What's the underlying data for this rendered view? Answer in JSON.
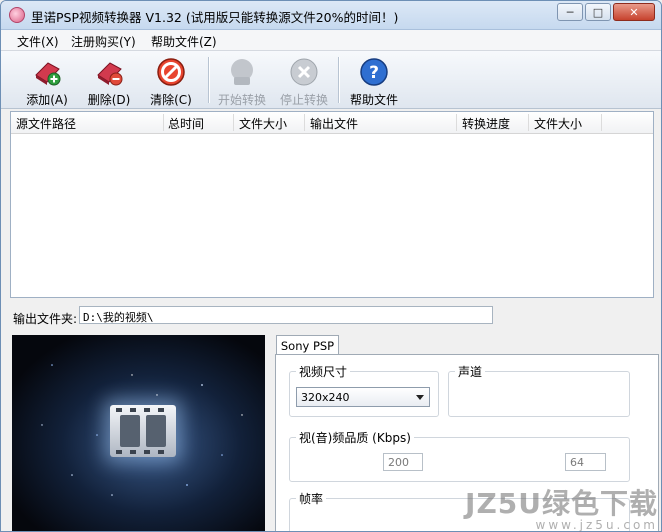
{
  "window": {
    "title": "里诺PSP视频转换器 V1.32 (试用版只能转换源文件20%的时间！)"
  },
  "caption_buttons": {
    "minimize": "─",
    "maximize": "□",
    "close": "✕"
  },
  "menu": [
    {
      "label": "文件(X)"
    },
    {
      "label": "注册购买(Y)"
    },
    {
      "label": "帮助文件(Z)"
    }
  ],
  "toolbar": {
    "add": {
      "label": "添加(A)",
      "icon": "add-file-icon",
      "enabled": true
    },
    "delete": {
      "label": "删除(D)",
      "icon": "delete-file-icon",
      "enabled": true
    },
    "clear": {
      "label": "清除(C)",
      "icon": "clear-icon",
      "enabled": true
    },
    "start": {
      "label": "开始转换",
      "icon": "start-convert-icon",
      "enabled": false
    },
    "stop": {
      "label": "停止转换",
      "icon": "stop-convert-icon",
      "enabled": false
    },
    "help": {
      "label": "帮助文件",
      "icon": "help-icon",
      "enabled": true
    }
  },
  "file_list": {
    "columns": [
      "源文件路径",
      "总时间",
      "文件大小",
      "输出文件",
      "转换进度",
      "文件大小"
    ],
    "rows": []
  },
  "output": {
    "label": "输出文件夹:",
    "value": "D:\\我的视频\\"
  },
  "settings": {
    "tab": "Sony PSP",
    "video_size": {
      "title": "视频尺寸",
      "selected": "320x240"
    },
    "audio_channel": {
      "title": "声道"
    },
    "quality": {
      "title": "视(音)频品质 (Kbps)",
      "video": "200",
      "audio": "64"
    },
    "frame_rate": {
      "title": "帧率"
    }
  },
  "watermark": {
    "line1": "JZ5U绿色下载",
    "line2": "www.jz5u.com"
  },
  "colors": {
    "title_bar": "#c6d9ef",
    "close_button": "#c6422d",
    "list_border": "#9fb0c4"
  }
}
